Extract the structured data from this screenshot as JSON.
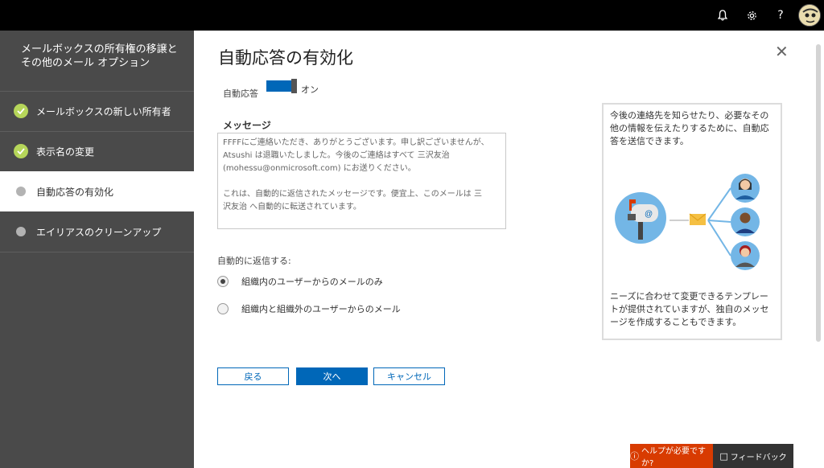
{
  "topbar": {
    "icons": [
      "bell-icon",
      "gear-icon",
      "help-icon",
      "avatar"
    ],
    "help_glyph": "?"
  },
  "sidebar": {
    "title": "メールボックスの所有権の移譲とその他のメール オプション",
    "steps": [
      {
        "label": "メールボックスの新しい所有者",
        "state": "done"
      },
      {
        "label": "表示名の変更",
        "state": "done"
      },
      {
        "label": "自動応答の有効化",
        "state": "current"
      },
      {
        "label": "エイリアスのクリーンアップ",
        "state": "pending"
      }
    ]
  },
  "main": {
    "title": "自動応答の有効化",
    "close_glyph": "✕",
    "toggle": {
      "label": "自動応答",
      "state": "オン",
      "on": true
    },
    "message": {
      "label": "メッセージ",
      "lines": [
        "FFFFにご連絡いただき、ありがとうございます。申し訳ございませんが、",
        "Atsushi は退職いたしました。今後のご連絡はすべて 三沢友治",
        "(mohessu@onmicrosoft.com) にお送りください。",
        "これは、自動的に返信されたメッセージです。便宜上、このメールは 三",
        "沢友治 へ自動的に転送されています。"
      ]
    },
    "reply": {
      "label": "自動的に返信する:",
      "options": [
        {
          "label": "組織内のユーザーからのメールのみ",
          "selected": true
        },
        {
          "label": "組織内と組織外のユーザーからのメール",
          "selected": false
        }
      ]
    },
    "buttons": {
      "back": "戻る",
      "next": "次へ",
      "cancel": "キャンセル"
    }
  },
  "info_card": {
    "top_text": "今後の連絡先を知らせたり、必要なその他の情報を伝えたりするために、自動応答を送信できます。",
    "bottom_text": "ニーズに合わせて変更できるテンプレートが提供されていますが、独自のメッセージを作成することもできます。"
  },
  "footer": {
    "help_label": "ヘルプが必要ですか?",
    "feedback_label": "フィードバック"
  },
  "colors": {
    "accent": "#0067b8",
    "sidebar": "#4a4a4a",
    "check": "#b6d65a",
    "help": "#d83b01"
  }
}
